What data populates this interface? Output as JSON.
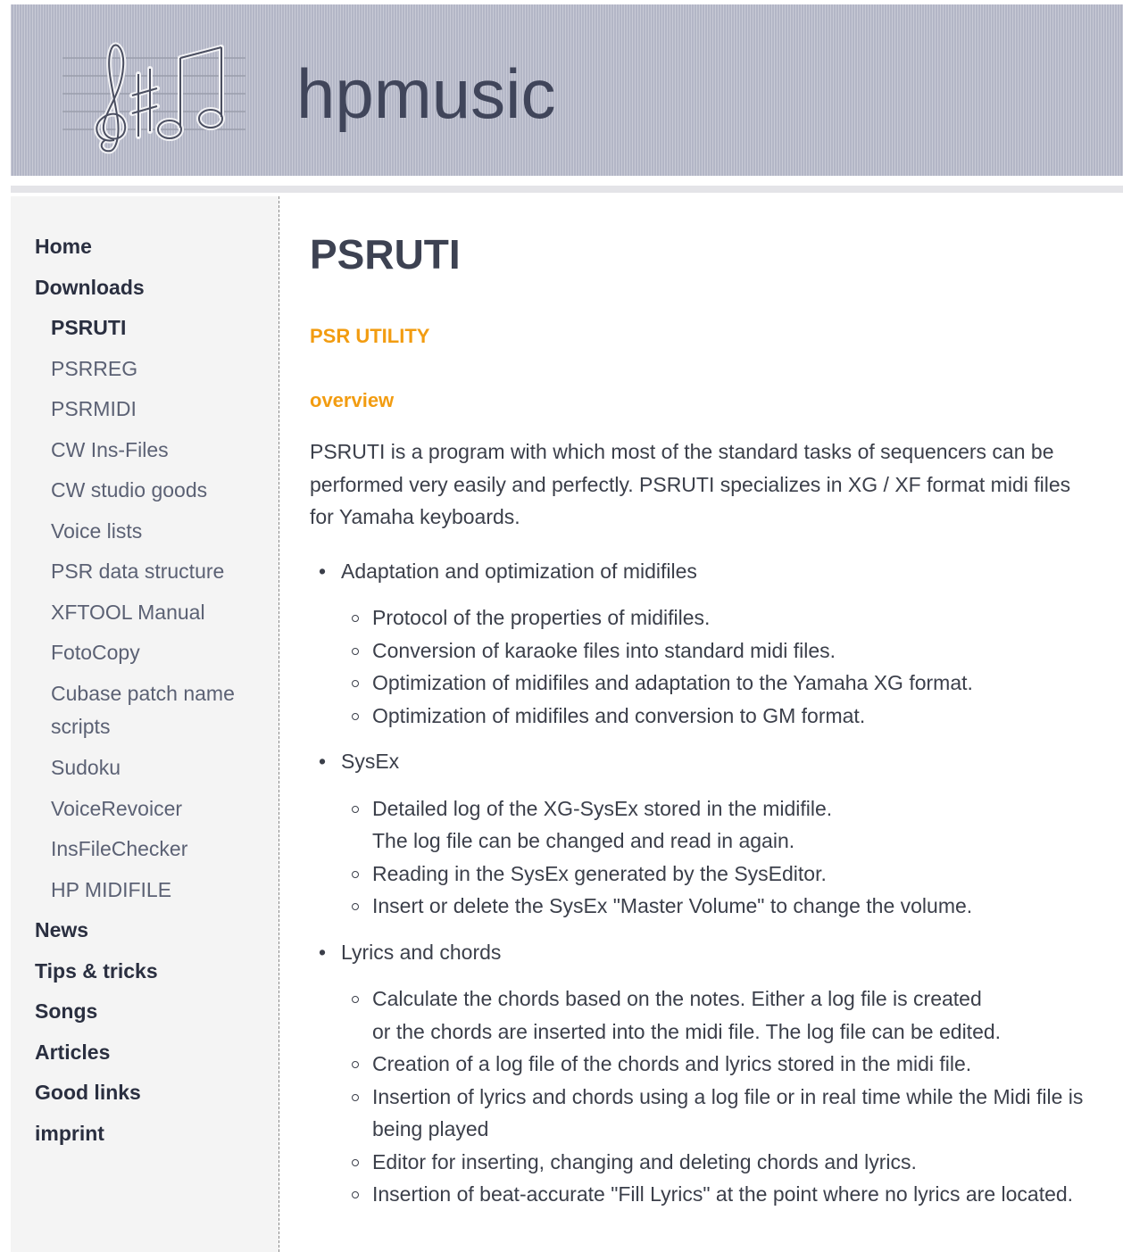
{
  "header": {
    "site_title": "hpmusic",
    "logo_icon": "music-notes-logo-icon"
  },
  "sidebar": {
    "items": [
      {
        "label": "Home",
        "level": "top",
        "active": false
      },
      {
        "label": "Downloads",
        "level": "top",
        "active": false
      },
      {
        "label": "PSRUTI",
        "level": "sub",
        "active": true
      },
      {
        "label": "PSRREG",
        "level": "sub",
        "active": false
      },
      {
        "label": "PSRMIDI",
        "level": "sub",
        "active": false
      },
      {
        "label": "CW Ins-Files",
        "level": "sub",
        "active": false
      },
      {
        "label": "CW studio goods",
        "level": "sub",
        "active": false
      },
      {
        "label": "Voice lists",
        "level": "sub",
        "active": false
      },
      {
        "label": "PSR data structure",
        "level": "sub",
        "active": false
      },
      {
        "label": "XFTOOL Manual",
        "level": "sub",
        "active": false
      },
      {
        "label": "FotoCopy",
        "level": "sub",
        "active": false
      },
      {
        "label": "Cubase patch name scripts",
        "level": "sub",
        "active": false
      },
      {
        "label": "Sudoku",
        "level": "sub",
        "active": false
      },
      {
        "label": "VoiceRevoicer",
        "level": "sub",
        "active": false
      },
      {
        "label": "InsFileChecker",
        "level": "sub",
        "active": false
      },
      {
        "label": "HP MIDIFILE",
        "level": "sub",
        "active": false
      },
      {
        "label": "News",
        "level": "top",
        "active": false
      },
      {
        "label": "Tips & tricks",
        "level": "top",
        "active": false
      },
      {
        "label": "Songs",
        "level": "top",
        "active": false
      },
      {
        "label": "Articles",
        "level": "top",
        "active": false
      },
      {
        "label": "Good links",
        "level": "top",
        "active": false
      },
      {
        "label": "imprint",
        "level": "top",
        "active": false
      }
    ]
  },
  "main": {
    "title": "PSRUTI",
    "section_caps": "PSR UTILITY",
    "section_sub": "overview",
    "intro": "PSRUTI is a program with which most of the standard tasks of sequencers can be performed very easily and perfectly. PSRUTI specializes in XG / XF format midi files for Yamaha keyboards.",
    "features": [
      {
        "title": "Adaptation and optimization of midifiles",
        "items": [
          "Protocol of the properties of midifiles.",
          "Conversion of karaoke files into standard midi files.",
          "Optimization of midifiles and adaptation to the Yamaha XG format.",
          "Optimization of midifiles and conversion to GM format."
        ]
      },
      {
        "title": "SysEx",
        "items": [
          "Detailed log of the XG-SysEx stored in the midifile.\nThe log file can be changed and read in again.",
          "Reading in the SysEx generated by the SysEditor.",
          "Insert or delete the SysEx \"Master Volume\" to change the volume."
        ]
      },
      {
        "title": "Lyrics and chords",
        "items": [
          "Calculate the chords based on the notes. Either a log file is created\nor the chords are inserted into the midi file. The log file can be edited.",
          "Creation of a log file of the chords and lyrics stored in the midi file.",
          "Insertion of lyrics and chords using a log file or in real time while the Midi file is being played",
          "Editor for inserting, changing and deleting chords and lyrics.",
          "Insertion of beat-accurate \"Fill Lyrics\" at the point where no lyrics are located."
        ]
      }
    ]
  },
  "colors": {
    "header_bg": "#b3b6c6",
    "accent_orange": "#f29c11",
    "text": "#3b3f4a",
    "sidebar_bg": "#f4f4f4"
  }
}
